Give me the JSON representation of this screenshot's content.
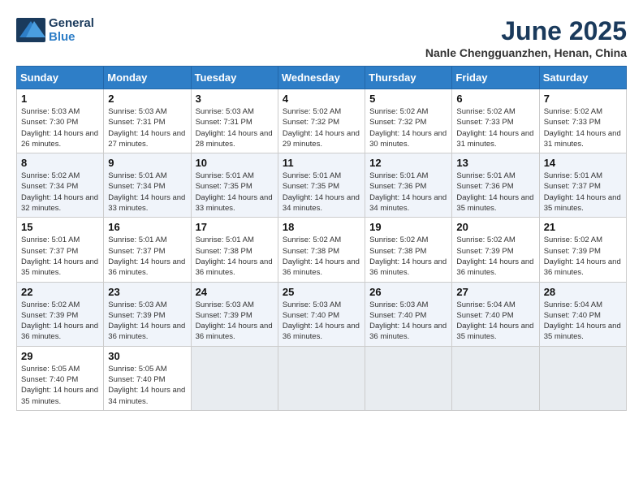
{
  "logo": {
    "line1": "General",
    "line2": "Blue"
  },
  "title": "June 2025",
  "location": "Nanle Chengguanzhen, Henan, China",
  "weekdays": [
    "Sunday",
    "Monday",
    "Tuesday",
    "Wednesday",
    "Thursday",
    "Friday",
    "Saturday"
  ],
  "weeks": [
    [
      {
        "day": "1",
        "sunrise": "Sunrise: 5:03 AM",
        "sunset": "Sunset: 7:30 PM",
        "daylight": "Daylight: 14 hours and 26 minutes."
      },
      {
        "day": "2",
        "sunrise": "Sunrise: 5:03 AM",
        "sunset": "Sunset: 7:31 PM",
        "daylight": "Daylight: 14 hours and 27 minutes."
      },
      {
        "day": "3",
        "sunrise": "Sunrise: 5:03 AM",
        "sunset": "Sunset: 7:31 PM",
        "daylight": "Daylight: 14 hours and 28 minutes."
      },
      {
        "day": "4",
        "sunrise": "Sunrise: 5:02 AM",
        "sunset": "Sunset: 7:32 PM",
        "daylight": "Daylight: 14 hours and 29 minutes."
      },
      {
        "day": "5",
        "sunrise": "Sunrise: 5:02 AM",
        "sunset": "Sunset: 7:32 PM",
        "daylight": "Daylight: 14 hours and 30 minutes."
      },
      {
        "day": "6",
        "sunrise": "Sunrise: 5:02 AM",
        "sunset": "Sunset: 7:33 PM",
        "daylight": "Daylight: 14 hours and 31 minutes."
      },
      {
        "day": "7",
        "sunrise": "Sunrise: 5:02 AM",
        "sunset": "Sunset: 7:33 PM",
        "daylight": "Daylight: 14 hours and 31 minutes."
      }
    ],
    [
      {
        "day": "8",
        "sunrise": "Sunrise: 5:02 AM",
        "sunset": "Sunset: 7:34 PM",
        "daylight": "Daylight: 14 hours and 32 minutes."
      },
      {
        "day": "9",
        "sunrise": "Sunrise: 5:01 AM",
        "sunset": "Sunset: 7:34 PM",
        "daylight": "Daylight: 14 hours and 33 minutes."
      },
      {
        "day": "10",
        "sunrise": "Sunrise: 5:01 AM",
        "sunset": "Sunset: 7:35 PM",
        "daylight": "Daylight: 14 hours and 33 minutes."
      },
      {
        "day": "11",
        "sunrise": "Sunrise: 5:01 AM",
        "sunset": "Sunset: 7:35 PM",
        "daylight": "Daylight: 14 hours and 34 minutes."
      },
      {
        "day": "12",
        "sunrise": "Sunrise: 5:01 AM",
        "sunset": "Sunset: 7:36 PM",
        "daylight": "Daylight: 14 hours and 34 minutes."
      },
      {
        "day": "13",
        "sunrise": "Sunrise: 5:01 AM",
        "sunset": "Sunset: 7:36 PM",
        "daylight": "Daylight: 14 hours and 35 minutes."
      },
      {
        "day": "14",
        "sunrise": "Sunrise: 5:01 AM",
        "sunset": "Sunset: 7:37 PM",
        "daylight": "Daylight: 14 hours and 35 minutes."
      }
    ],
    [
      {
        "day": "15",
        "sunrise": "Sunrise: 5:01 AM",
        "sunset": "Sunset: 7:37 PM",
        "daylight": "Daylight: 14 hours and 35 minutes."
      },
      {
        "day": "16",
        "sunrise": "Sunrise: 5:01 AM",
        "sunset": "Sunset: 7:37 PM",
        "daylight": "Daylight: 14 hours and 36 minutes."
      },
      {
        "day": "17",
        "sunrise": "Sunrise: 5:01 AM",
        "sunset": "Sunset: 7:38 PM",
        "daylight": "Daylight: 14 hours and 36 minutes."
      },
      {
        "day": "18",
        "sunrise": "Sunrise: 5:02 AM",
        "sunset": "Sunset: 7:38 PM",
        "daylight": "Daylight: 14 hours and 36 minutes."
      },
      {
        "day": "19",
        "sunrise": "Sunrise: 5:02 AM",
        "sunset": "Sunset: 7:38 PM",
        "daylight": "Daylight: 14 hours and 36 minutes."
      },
      {
        "day": "20",
        "sunrise": "Sunrise: 5:02 AM",
        "sunset": "Sunset: 7:39 PM",
        "daylight": "Daylight: 14 hours and 36 minutes."
      },
      {
        "day": "21",
        "sunrise": "Sunrise: 5:02 AM",
        "sunset": "Sunset: 7:39 PM",
        "daylight": "Daylight: 14 hours and 36 minutes."
      }
    ],
    [
      {
        "day": "22",
        "sunrise": "Sunrise: 5:02 AM",
        "sunset": "Sunset: 7:39 PM",
        "daylight": "Daylight: 14 hours and 36 minutes."
      },
      {
        "day": "23",
        "sunrise": "Sunrise: 5:03 AM",
        "sunset": "Sunset: 7:39 PM",
        "daylight": "Daylight: 14 hours and 36 minutes."
      },
      {
        "day": "24",
        "sunrise": "Sunrise: 5:03 AM",
        "sunset": "Sunset: 7:39 PM",
        "daylight": "Daylight: 14 hours and 36 minutes."
      },
      {
        "day": "25",
        "sunrise": "Sunrise: 5:03 AM",
        "sunset": "Sunset: 7:40 PM",
        "daylight": "Daylight: 14 hours and 36 minutes."
      },
      {
        "day": "26",
        "sunrise": "Sunrise: 5:03 AM",
        "sunset": "Sunset: 7:40 PM",
        "daylight": "Daylight: 14 hours and 36 minutes."
      },
      {
        "day": "27",
        "sunrise": "Sunrise: 5:04 AM",
        "sunset": "Sunset: 7:40 PM",
        "daylight": "Daylight: 14 hours and 35 minutes."
      },
      {
        "day": "28",
        "sunrise": "Sunrise: 5:04 AM",
        "sunset": "Sunset: 7:40 PM",
        "daylight": "Daylight: 14 hours and 35 minutes."
      }
    ],
    [
      {
        "day": "29",
        "sunrise": "Sunrise: 5:05 AM",
        "sunset": "Sunset: 7:40 PM",
        "daylight": "Daylight: 14 hours and 35 minutes."
      },
      {
        "day": "30",
        "sunrise": "Sunrise: 5:05 AM",
        "sunset": "Sunset: 7:40 PM",
        "daylight": "Daylight: 14 hours and 34 minutes."
      },
      null,
      null,
      null,
      null,
      null
    ]
  ]
}
